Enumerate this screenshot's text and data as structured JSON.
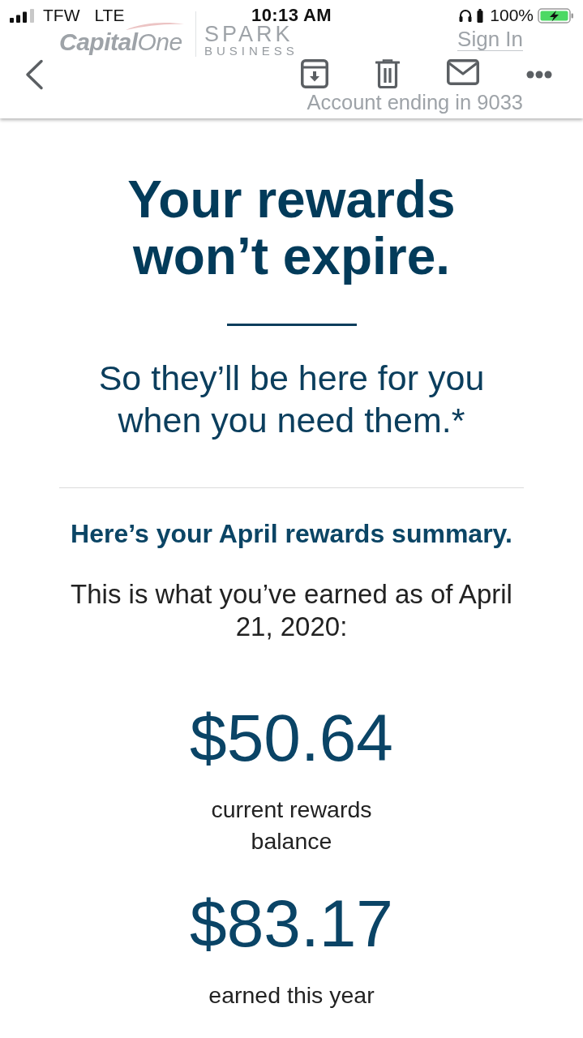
{
  "status_bar": {
    "carrier": "TFW",
    "network": "LTE",
    "time": "10:13 AM",
    "battery": "100%"
  },
  "email_header": {
    "logo": "**Capital**One",
    "product": "SPARK",
    "product_sub": "BUSINESS",
    "sign_in": "Sign In",
    "account": "Account ending in 9033"
  },
  "email": {
    "headline": "Your rewards won’t expire.",
    "subheadline": "So they’ll be here for you when you need them.*",
    "summary_title": "Here’s your April rewards summary.",
    "summary_text": "This is what you’ve earned as of April 21, 2020:",
    "stats": [
      {
        "amount": "$50.64",
        "label": "current rewards balance"
      },
      {
        "amount": "$83.17",
        "label": "earned this year"
      }
    ]
  }
}
